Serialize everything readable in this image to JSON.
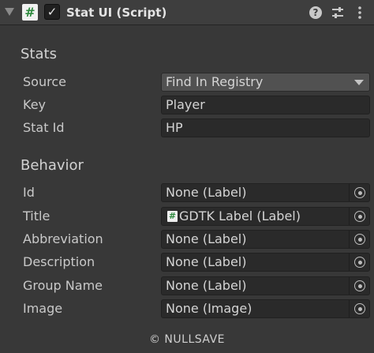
{
  "header": {
    "title": "Stat UI (Script)",
    "script_icon_glyph": "#",
    "enabled_glyph": "✓",
    "help_glyph": "?"
  },
  "stats": {
    "heading": "Stats",
    "source": {
      "label": "Source",
      "value": "Find In Registry"
    },
    "key": {
      "label": "Key",
      "value": "Player"
    },
    "stat_id": {
      "label": "Stat Id",
      "value": "HP"
    }
  },
  "behavior": {
    "heading": "Behavior",
    "fields": [
      {
        "label": "Id",
        "value": "None (Label)"
      },
      {
        "label": "Title",
        "value": "GDTK Label (Label)",
        "icon_glyph": "#"
      },
      {
        "label": "Abbreviation",
        "value": "None (Label)"
      },
      {
        "label": "Description",
        "value": "None (Label)"
      },
      {
        "label": "Group Name",
        "value": "None (Label)"
      },
      {
        "label": "Image",
        "value": "None (Image)"
      }
    ]
  },
  "footer": {
    "text": "© NULLSAVE"
  },
  "colors": {
    "background": "#383838",
    "header": "#3e3e3e",
    "field": "#2a2a2a",
    "dropdown": "#515151",
    "script_icon_green": "#2e8a3e"
  }
}
